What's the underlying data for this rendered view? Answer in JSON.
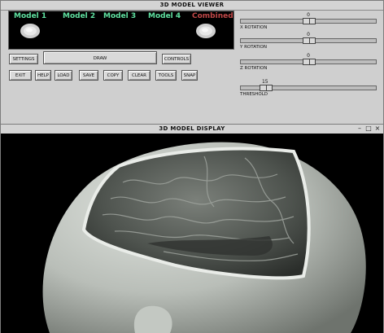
{
  "viewer": {
    "title": "3D MODEL VIEWER",
    "models": [
      {
        "label": "Model 1",
        "color": "#5fe0a0"
      },
      {
        "label": "Model 2",
        "color": "#5fe0a0"
      },
      {
        "label": "Model 3",
        "color": "#5fe0a0"
      },
      {
        "label": "Model 4",
        "color": "#5fe0a0"
      },
      {
        "label": "Combined",
        "color": "#c04848"
      }
    ],
    "buttons": {
      "settings": "SETTINGS",
      "draw": "DRAW",
      "controls": "CONTROLS",
      "exit": "EXIT",
      "help": "HELP",
      "load": "LOAD",
      "save": "SAVE",
      "copy": "COPY",
      "clear": "CLEAR",
      "tools": "TOOLS",
      "snap": "SNAP"
    },
    "sliders": [
      {
        "label": "X ROTATION",
        "value": "0",
        "fraction": 0.5
      },
      {
        "label": "Y ROTATION",
        "value": "0",
        "fraction": 0.5
      },
      {
        "label": "Z ROTATION",
        "value": "0",
        "fraction": 0.5
      },
      {
        "label": "THRESHOLD",
        "value": "15",
        "fraction": 0.15
      }
    ]
  },
  "display": {
    "title": "3D MODEL DISPLAY"
  },
  "colors": {
    "window_bg": "#cfcfcf",
    "model_label": "#5fe0a0",
    "combined_label": "#c04848"
  }
}
